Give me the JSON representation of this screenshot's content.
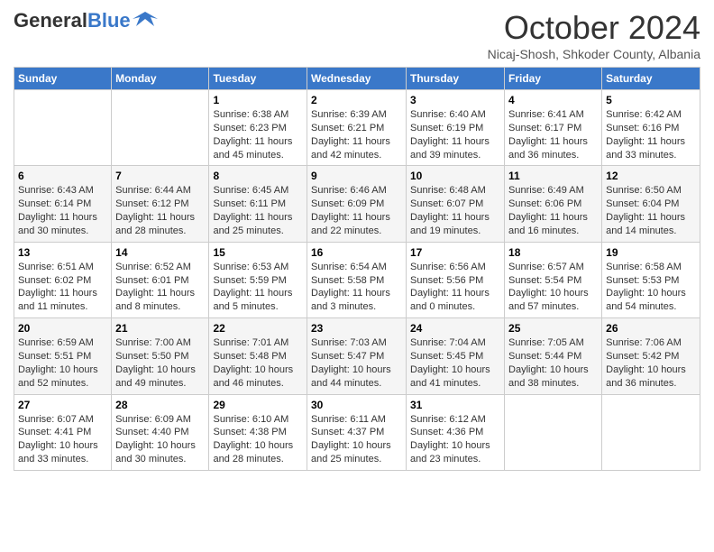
{
  "header": {
    "logo_general": "General",
    "logo_blue": "Blue",
    "month_title": "October 2024",
    "subtitle": "Nicaj-Shosh, Shkoder County, Albania"
  },
  "days_of_week": [
    "Sunday",
    "Monday",
    "Tuesday",
    "Wednesday",
    "Thursday",
    "Friday",
    "Saturday"
  ],
  "weeks": [
    [
      {
        "day": "",
        "info": ""
      },
      {
        "day": "",
        "info": ""
      },
      {
        "day": "1",
        "info": "Sunrise: 6:38 AM\nSunset: 6:23 PM\nDaylight: 11 hours and 45 minutes."
      },
      {
        "day": "2",
        "info": "Sunrise: 6:39 AM\nSunset: 6:21 PM\nDaylight: 11 hours and 42 minutes."
      },
      {
        "day": "3",
        "info": "Sunrise: 6:40 AM\nSunset: 6:19 PM\nDaylight: 11 hours and 39 minutes."
      },
      {
        "day": "4",
        "info": "Sunrise: 6:41 AM\nSunset: 6:17 PM\nDaylight: 11 hours and 36 minutes."
      },
      {
        "day": "5",
        "info": "Sunrise: 6:42 AM\nSunset: 6:16 PM\nDaylight: 11 hours and 33 minutes."
      }
    ],
    [
      {
        "day": "6",
        "info": "Sunrise: 6:43 AM\nSunset: 6:14 PM\nDaylight: 11 hours and 30 minutes."
      },
      {
        "day": "7",
        "info": "Sunrise: 6:44 AM\nSunset: 6:12 PM\nDaylight: 11 hours and 28 minutes."
      },
      {
        "day": "8",
        "info": "Sunrise: 6:45 AM\nSunset: 6:11 PM\nDaylight: 11 hours and 25 minutes."
      },
      {
        "day": "9",
        "info": "Sunrise: 6:46 AM\nSunset: 6:09 PM\nDaylight: 11 hours and 22 minutes."
      },
      {
        "day": "10",
        "info": "Sunrise: 6:48 AM\nSunset: 6:07 PM\nDaylight: 11 hours and 19 minutes."
      },
      {
        "day": "11",
        "info": "Sunrise: 6:49 AM\nSunset: 6:06 PM\nDaylight: 11 hours and 16 minutes."
      },
      {
        "day": "12",
        "info": "Sunrise: 6:50 AM\nSunset: 6:04 PM\nDaylight: 11 hours and 14 minutes."
      }
    ],
    [
      {
        "day": "13",
        "info": "Sunrise: 6:51 AM\nSunset: 6:02 PM\nDaylight: 11 hours and 11 minutes."
      },
      {
        "day": "14",
        "info": "Sunrise: 6:52 AM\nSunset: 6:01 PM\nDaylight: 11 hours and 8 minutes."
      },
      {
        "day": "15",
        "info": "Sunrise: 6:53 AM\nSunset: 5:59 PM\nDaylight: 11 hours and 5 minutes."
      },
      {
        "day": "16",
        "info": "Sunrise: 6:54 AM\nSunset: 5:58 PM\nDaylight: 11 hours and 3 minutes."
      },
      {
        "day": "17",
        "info": "Sunrise: 6:56 AM\nSunset: 5:56 PM\nDaylight: 11 hours and 0 minutes."
      },
      {
        "day": "18",
        "info": "Sunrise: 6:57 AM\nSunset: 5:54 PM\nDaylight: 10 hours and 57 minutes."
      },
      {
        "day": "19",
        "info": "Sunrise: 6:58 AM\nSunset: 5:53 PM\nDaylight: 10 hours and 54 minutes."
      }
    ],
    [
      {
        "day": "20",
        "info": "Sunrise: 6:59 AM\nSunset: 5:51 PM\nDaylight: 10 hours and 52 minutes."
      },
      {
        "day": "21",
        "info": "Sunrise: 7:00 AM\nSunset: 5:50 PM\nDaylight: 10 hours and 49 minutes."
      },
      {
        "day": "22",
        "info": "Sunrise: 7:01 AM\nSunset: 5:48 PM\nDaylight: 10 hours and 46 minutes."
      },
      {
        "day": "23",
        "info": "Sunrise: 7:03 AM\nSunset: 5:47 PM\nDaylight: 10 hours and 44 minutes."
      },
      {
        "day": "24",
        "info": "Sunrise: 7:04 AM\nSunset: 5:45 PM\nDaylight: 10 hours and 41 minutes."
      },
      {
        "day": "25",
        "info": "Sunrise: 7:05 AM\nSunset: 5:44 PM\nDaylight: 10 hours and 38 minutes."
      },
      {
        "day": "26",
        "info": "Sunrise: 7:06 AM\nSunset: 5:42 PM\nDaylight: 10 hours and 36 minutes."
      }
    ],
    [
      {
        "day": "27",
        "info": "Sunrise: 6:07 AM\nSunset: 4:41 PM\nDaylight: 10 hours and 33 minutes."
      },
      {
        "day": "28",
        "info": "Sunrise: 6:09 AM\nSunset: 4:40 PM\nDaylight: 10 hours and 30 minutes."
      },
      {
        "day": "29",
        "info": "Sunrise: 6:10 AM\nSunset: 4:38 PM\nDaylight: 10 hours and 28 minutes."
      },
      {
        "day": "30",
        "info": "Sunrise: 6:11 AM\nSunset: 4:37 PM\nDaylight: 10 hours and 25 minutes."
      },
      {
        "day": "31",
        "info": "Sunrise: 6:12 AM\nSunset: 4:36 PM\nDaylight: 10 hours and 23 minutes."
      },
      {
        "day": "",
        "info": ""
      },
      {
        "day": "",
        "info": ""
      }
    ]
  ]
}
